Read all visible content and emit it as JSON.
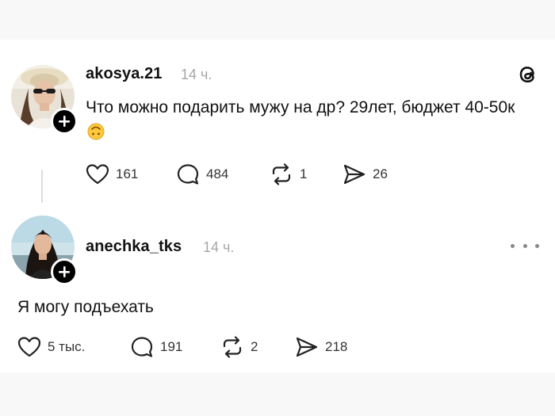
{
  "post": {
    "username": "akosya.21",
    "time": "14 ч.",
    "text": "Что можно подарить мужу на др? 29лет, бюджет 40-50к",
    "emoji_icon": "upside-down-face-emoji",
    "likes": "161",
    "comments": "484",
    "reposts": "1",
    "shares": "26"
  },
  "reply": {
    "username": "anechka_tks",
    "time": "14 ч.",
    "text": "Я могу подъехать",
    "likes": "5 тыс.",
    "comments": "191",
    "reposts": "2",
    "shares": "218"
  },
  "icons": {
    "app_logo": "threads-logo-icon",
    "like": "heart-icon",
    "comment": "comment-bubble-icon",
    "repost": "repost-icon",
    "share": "send-icon",
    "more": "more-options-icon",
    "follow": "plus-icon"
  },
  "colors": {
    "background": "#ffffff",
    "outer": "#f8f8f8",
    "text": "#111111",
    "muted": "#a8a8a8",
    "badge": "#000000"
  }
}
